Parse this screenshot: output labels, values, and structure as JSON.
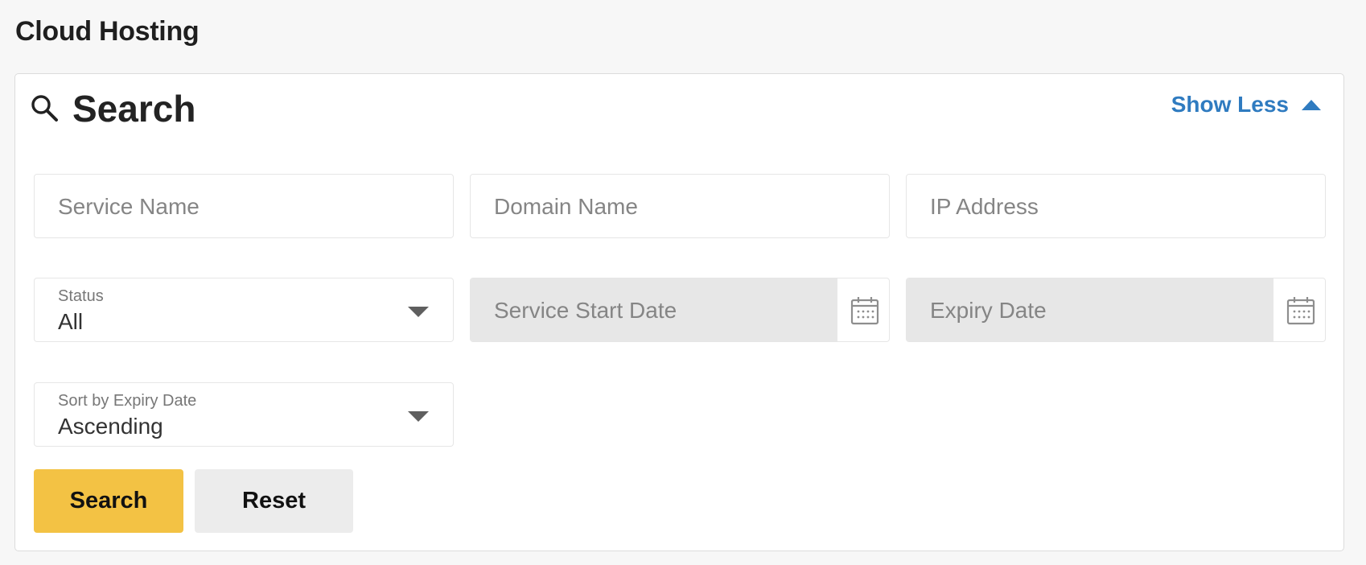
{
  "page": {
    "title": "Cloud Hosting"
  },
  "search_panel": {
    "title": "Search",
    "toggle_label": "Show Less",
    "fields": {
      "service_name": {
        "placeholder": "Service Name"
      },
      "domain_name": {
        "placeholder": "Domain Name"
      },
      "ip_address": {
        "placeholder": "IP Address"
      },
      "status": {
        "label": "Status",
        "value": "All"
      },
      "service_start_date": {
        "placeholder": "Service Start Date"
      },
      "expiry_date": {
        "placeholder": "Expiry Date"
      },
      "sort_by_expiry": {
        "label": "Sort by Expiry Date",
        "value": "Ascending"
      }
    },
    "buttons": {
      "search": "Search",
      "reset": "Reset"
    }
  },
  "colors": {
    "accent_link": "#2f7bc0",
    "primary_button": "#f3c244",
    "secondary_button": "#ececec",
    "disabled_field": "#e7e7e7"
  },
  "icons": [
    "search-icon",
    "chevron-up-icon",
    "chevron-down-icon",
    "calendar-icon"
  ]
}
